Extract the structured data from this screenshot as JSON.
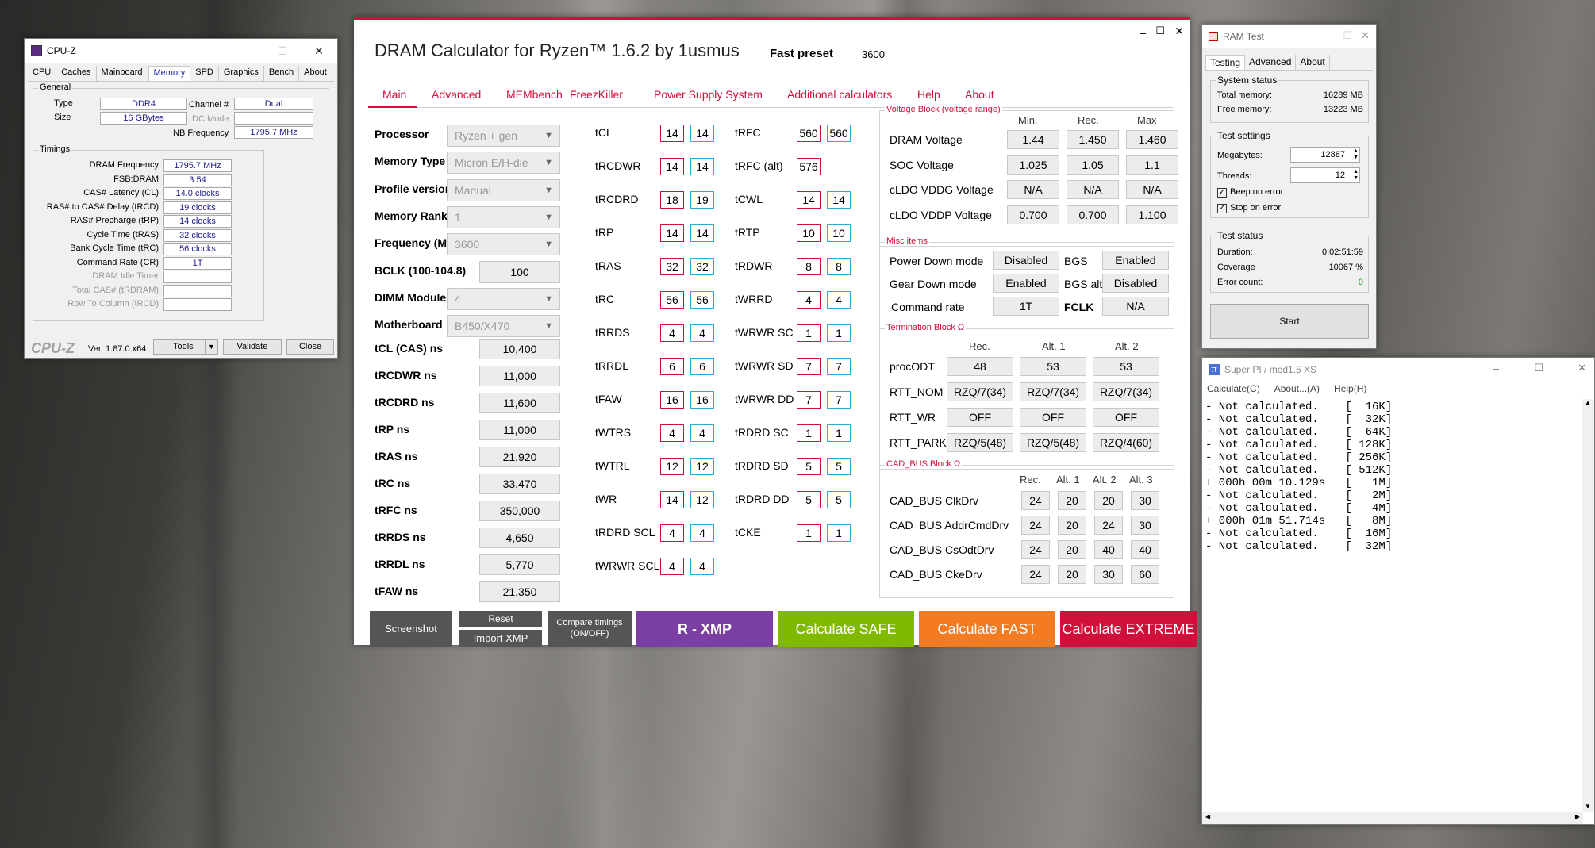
{
  "cpuz": {
    "title": "CPU-Z",
    "tabs": [
      "CPU",
      "Caches",
      "Mainboard",
      "Memory",
      "SPD",
      "Graphics",
      "Bench",
      "About"
    ],
    "active_tab": "Memory",
    "general_title": "General",
    "type_label": "Type",
    "type": "DDR4",
    "size_label": "Size",
    "size": "16 GBytes",
    "channel_label": "Channel #",
    "channel": "Dual",
    "dcmode_label": "DC Mode",
    "nbfreq_label": "NB Frequency",
    "nbfreq": "1795.7 MHz",
    "timings_title": "Timings",
    "timings": [
      {
        "label": "DRAM Frequency",
        "value": "1795.7 MHz"
      },
      {
        "label": "FSB:DRAM",
        "value": "3:54"
      },
      {
        "label": "CAS# Latency (CL)",
        "value": "14.0 clocks"
      },
      {
        "label": "RAS# to CAS# Delay (tRCD)",
        "value": "19 clocks"
      },
      {
        "label": "RAS# Precharge (tRP)",
        "value": "14 clocks"
      },
      {
        "label": "Cycle Time (tRAS)",
        "value": "32 clocks"
      },
      {
        "label": "Bank Cycle Time (tRC)",
        "value": "56 clocks"
      },
      {
        "label": "Command Rate (CR)",
        "value": "1T"
      },
      {
        "label": "DRAM Idle Timer",
        "value": ""
      },
      {
        "label": "Total CAS# (tRDRAM)",
        "value": ""
      },
      {
        "label": "Row To Column (tRCD)",
        "value": ""
      }
    ],
    "brand": "CPU-Z",
    "version": "Ver. 1.87.0.x64",
    "tools": "Tools",
    "validate": "Validate",
    "close": "Close"
  },
  "dram": {
    "title": "DRAM Calculator for Ryzen™ 1.6.2 by 1usmus",
    "fast_preset_label": "Fast preset",
    "fast_preset_value": "3600",
    "tabs": [
      "Main",
      "Advanced",
      "MEMbench",
      "FreezKiller",
      "Power Supply System",
      "Additional calculators",
      "Help",
      "About"
    ],
    "params": [
      {
        "label": "Processor",
        "value": "Ryzen + gen"
      },
      {
        "label": "Memory Type",
        "value": "Micron E/H-die"
      },
      {
        "label": "Profile version",
        "value": "Manual"
      },
      {
        "label": "Memory Rank",
        "value": "1"
      },
      {
        "label": "Frequency (MT/s)",
        "value": "3600"
      },
      {
        "label": "BCLK (100-104.8)",
        "value": "100"
      },
      {
        "label": "DIMM Modules",
        "value": "4"
      },
      {
        "label": "Motherboard",
        "value": "B450/X470"
      }
    ],
    "ns": [
      {
        "label": "tCL (CAS) ns",
        "value": "10,400"
      },
      {
        "label": "tRCDWR ns",
        "value": "11,000"
      },
      {
        "label": "tRCDRD ns",
        "value": "11,600"
      },
      {
        "label": "tRP ns",
        "value": "11,000"
      },
      {
        "label": "tRAS ns",
        "value": "21,920"
      },
      {
        "label": "tRC ns",
        "value": "33,470"
      },
      {
        "label": "tRFC ns",
        "value": "350,000"
      },
      {
        "label": "tRRDS ns",
        "value": "4,650"
      },
      {
        "label": "tRRDL ns",
        "value": "5,770"
      },
      {
        "label": "tFAW ns",
        "value": "21,350"
      }
    ],
    "tcol1": [
      {
        "label": "tCL",
        "a": "14",
        "b": "14"
      },
      {
        "label": "tRCDWR",
        "a": "14",
        "b": "14"
      },
      {
        "label": "tRCDRD",
        "a": "18",
        "b": "19"
      },
      {
        "label": "tRP",
        "a": "14",
        "b": "14"
      },
      {
        "label": "tRAS",
        "a": "32",
        "b": "32"
      },
      {
        "label": "tRC",
        "a": "56",
        "b": "56"
      },
      {
        "label": "tRRDS",
        "a": "4",
        "b": "4"
      },
      {
        "label": "tRRDL",
        "a": "6",
        "b": "6"
      },
      {
        "label": "tFAW",
        "a": "16",
        "b": "16"
      },
      {
        "label": "tWTRS",
        "a": "4",
        "b": "4"
      },
      {
        "label": "tWTRL",
        "a": "12",
        "b": "12"
      },
      {
        "label": "tWR",
        "a": "14",
        "b": "12"
      },
      {
        "label": "tRDRD SCL",
        "a": "4",
        "b": "4"
      },
      {
        "label": "tWRWR SCL",
        "a": "4",
        "b": "4"
      }
    ],
    "tcol2": [
      {
        "label": "tRFC",
        "a": "560",
        "b": "560"
      },
      {
        "label": "tRFC (alt)",
        "a": "576",
        "b": ""
      },
      {
        "label": "tCWL",
        "a": "14",
        "b": "14"
      },
      {
        "label": "tRTP",
        "a": "10",
        "b": "10"
      },
      {
        "label": "tRDWR",
        "a": "8",
        "b": "8"
      },
      {
        "label": "tWRRD",
        "a": "4",
        "b": "4"
      },
      {
        "label": "tWRWR SC",
        "a": "1",
        "b": "1"
      },
      {
        "label": "tWRWR SD",
        "a": "7",
        "b": "7"
      },
      {
        "label": "tWRWR DD",
        "a": "7",
        "b": "7"
      },
      {
        "label": "tRDRD SC",
        "a": "1",
        "b": "1"
      },
      {
        "label": "tRDRD SD",
        "a": "5",
        "b": "5"
      },
      {
        "label": "tRDRD DD",
        "a": "5",
        "b": "5"
      },
      {
        "label": "tCKE",
        "a": "1",
        "b": "1"
      }
    ],
    "voltage": {
      "title": "Voltage Block (voltage range)",
      "cols": [
        "Min.",
        "Rec.",
        "Max"
      ],
      "rows": [
        {
          "label": "DRAM Voltage",
          "v": [
            "1.44",
            "1.450",
            "1.460"
          ]
        },
        {
          "label": "SOC Voltage",
          "v": [
            "1.025",
            "1.05",
            "1.1"
          ]
        },
        {
          "label": "cLDO VDDG Voltage",
          "v": [
            "N/A",
            "N/A",
            "N/A"
          ]
        },
        {
          "label": "cLDO VDDP Voltage",
          "v": [
            "0.700",
            "0.700",
            "1.100"
          ]
        }
      ]
    },
    "misc": {
      "title": "Misc items",
      "pdm_label": "Power Down mode",
      "pdm": "Disabled",
      "bgs_label": "BGS",
      "bgs": "Enabled",
      "gdm_label": "Gear Down mode",
      "gdm": "Enabled",
      "bgsalt_label": "BGS alt",
      "bgsalt": "Disabled",
      "cr_label": "Command rate",
      "cr": "1T",
      "fclk_label": "FCLK",
      "fclk": "N/A"
    },
    "term": {
      "title": "Termination Block Ω",
      "cols": [
        "Rec.",
        "Alt. 1",
        "Alt. 2"
      ],
      "rows": [
        {
          "label": "procODT",
          "v": [
            "48",
            "53",
            "53"
          ]
        },
        {
          "label": "RTT_NOM",
          "v": [
            "RZQ/7(34)",
            "RZQ/7(34)",
            "RZQ/7(34)"
          ]
        },
        {
          "label": "RTT_WR",
          "v": [
            "OFF",
            "OFF",
            "OFF"
          ]
        },
        {
          "label": "RTT_PARK",
          "v": [
            "RZQ/5(48)",
            "RZQ/5(48)",
            "RZQ/4(60)"
          ]
        }
      ]
    },
    "cad": {
      "title": "CAD_BUS Block Ω",
      "cols": [
        "Rec.",
        "Alt. 1",
        "Alt. 2",
        "Alt. 3"
      ],
      "rows": [
        {
          "label": "CAD_BUS ClkDrv",
          "v": [
            "24",
            "20",
            "20",
            "30"
          ]
        },
        {
          "label": "CAD_BUS AddrCmdDrv",
          "v": [
            "24",
            "20",
            "24",
            "30"
          ]
        },
        {
          "label": "CAD_BUS CsOdtDrv",
          "v": [
            "24",
            "20",
            "40",
            "40"
          ]
        },
        {
          "label": "CAD_BUS CkeDrv",
          "v": [
            "24",
            "20",
            "30",
            "60"
          ]
        }
      ]
    },
    "buttons": {
      "screenshot": "Screenshot",
      "reset": "Reset",
      "import": "Import XMP",
      "compare": "Compare timings (ON/OFF)",
      "rxmp": "R - XMP",
      "safe": "Calculate SAFE",
      "fast": "Calculate FAST",
      "extreme": "Calculate EXTREME"
    },
    "colors": {
      "accent": "#d0103a",
      "purple": "#7b3fa3",
      "green": "#7fba00",
      "orange": "#f47b20",
      "red": "#d0103a"
    }
  },
  "ramtest": {
    "title": "RAM Test",
    "tabs": [
      "Testing",
      "Advanced",
      "About"
    ],
    "status_title": "System status",
    "total_label": "Total memory:",
    "total": "16289 MB",
    "free_label": "Free memory:",
    "free": "13223 MB",
    "settings_title": "Test settings",
    "mb_label": "Megabytes:",
    "mb": "12887",
    "threads_label": "Threads:",
    "threads": "12",
    "beep": "Beep on error",
    "stop": "Stop on error",
    "teststatus_title": "Test status",
    "dur_label": "Duration:",
    "dur": "0:02:51:59",
    "cov_label": "Coverage",
    "cov": "10067 %",
    "err_label": "Error count:",
    "err": "0",
    "start": "Start"
  },
  "superpi": {
    "title": "Super PI / mod1.5 XS",
    "menu": [
      "Calculate(C)",
      "About...(A)",
      "Help(H)"
    ],
    "lines": [
      "- Not calculated.    [  16K]",
      "- Not calculated.    [  32K]",
      "- Not calculated.    [  64K]",
      "- Not calculated.    [ 128K]",
      "- Not calculated.    [ 256K]",
      "- Not calculated.    [ 512K]",
      "+ 000h 00m 10.129s   [   1M]",
      "- Not calculated.    [   2M]",
      "- Not calculated.    [   4M]",
      "+ 000h 01m 51.714s   [   8M]",
      "- Not calculated.    [  16M]",
      "- Not calculated.    [  32M]"
    ]
  }
}
